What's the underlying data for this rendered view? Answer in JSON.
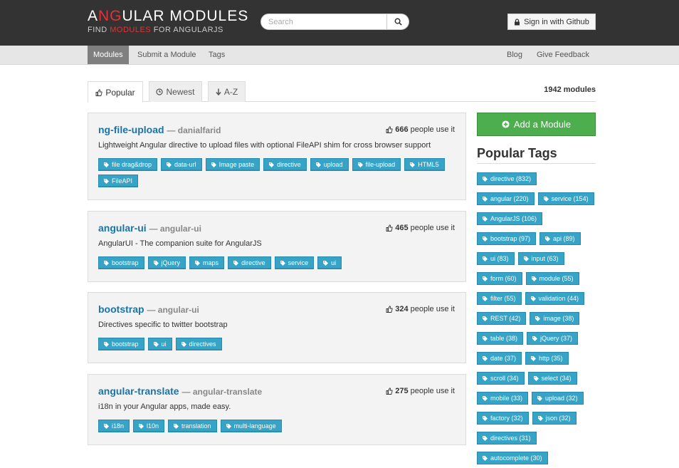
{
  "header": {
    "logo_title_pre": "A",
    "logo_title_ng": "NG",
    "logo_title_post": "ULAR MODULES",
    "logo_sub_pre": "FIND ",
    "logo_sub_hl": "MODULES",
    "logo_sub_post": " FOR ANGULARJS",
    "search_placeholder": "Search",
    "search_value": "",
    "signin_label": "Sign in with Github"
  },
  "nav": {
    "left": [
      "Modules",
      "Submit a Module",
      "Tags"
    ],
    "right": [
      "Blog",
      "Give Feedback"
    ],
    "active": "Modules"
  },
  "tabs": {
    "items": [
      "Popular",
      "Newest",
      "A-Z"
    ],
    "active": "Popular",
    "count": "1942 modules"
  },
  "modules": [
    {
      "name": "ng-file-upload",
      "author": "danialfarid",
      "users": "666",
      "users_suffix": "people use it",
      "description": "Lightweight Angular directive to upload files with optional FileAPI shim for cross browser support",
      "tags": [
        "file drag&drop",
        "data-url",
        "Image paste",
        "directive",
        "upload",
        "file-upload",
        "HTML5",
        "FileAPI"
      ]
    },
    {
      "name": "angular-ui",
      "author": "angular-ui",
      "users": "465",
      "users_suffix": "people use it",
      "description": "AngularUI - The companion suite for AngularJS",
      "tags": [
        "bootstrap",
        "jQuery",
        "maps",
        "directive",
        "service",
        "ui"
      ]
    },
    {
      "name": "bootstrap",
      "author": "angular-ui",
      "users": "324",
      "users_suffix": "people use it",
      "description": "Directives specific to twitter bootstrap",
      "tags": [
        "bootstrap",
        "ui",
        "directives"
      ]
    },
    {
      "name": "angular-translate",
      "author": "angular-translate",
      "users": "275",
      "users_suffix": "people use it",
      "description": "i18n in your Angular apps, made easy.",
      "tags": [
        "i18n",
        "l10n",
        "translation",
        "multi-language"
      ]
    }
  ],
  "sidebar": {
    "add_label": "Add a Module",
    "title": "Popular Tags",
    "tags": [
      [
        "directive (832)"
      ],
      [
        "angular (220)",
        "service (154)"
      ],
      [
        "AngularJS (106)"
      ],
      [
        "bootstrap (97)",
        "api (89)"
      ],
      [
        "ui (83)",
        "input (63)"
      ],
      [
        "form (60)",
        "module (55)"
      ],
      [
        "filter (55)",
        "validation (44)"
      ],
      [
        "REST (42)",
        "image (38)"
      ],
      [
        "table (38)",
        "jQuery (37)"
      ],
      [
        "date (37)",
        "http (35)"
      ],
      [
        "scroll (34)",
        "select (34)"
      ],
      [
        "mobile (33)",
        "upload (32)"
      ],
      [
        "factory (32)",
        "json (32)"
      ],
      [
        "directives (31)"
      ],
      [
        "autocomplete (30)"
      ]
    ]
  },
  "colors": {
    "header_bg": "#333333",
    "accent_red": "#e23237",
    "link_blue": "#1a74a8",
    "tag_blue": "#36a3c7",
    "add_green": "#4cae4c"
  }
}
